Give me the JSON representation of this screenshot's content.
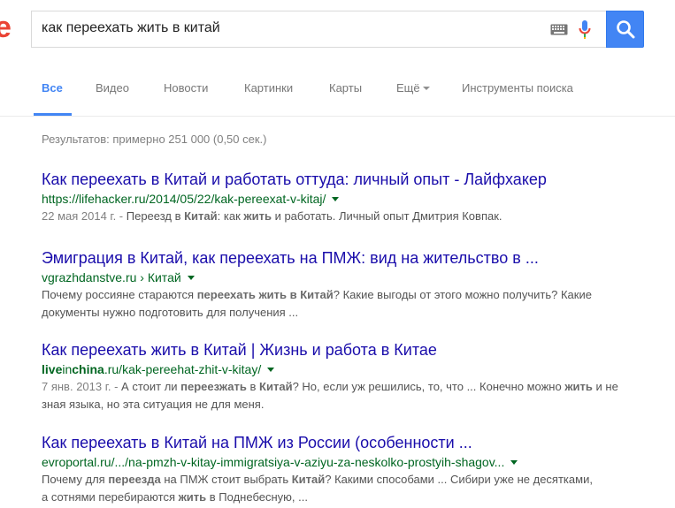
{
  "header": {
    "logo_fragment": "e",
    "search_query": "как переехать жить в китай",
    "icons": [
      "keyboard-icon",
      "microphone-icon",
      "search-icon"
    ],
    "colors": {
      "brand_blue": "#4285f4",
      "logo_red": "#ea4335"
    }
  },
  "tabs": {
    "all": "Все",
    "video": "Видео",
    "news": "Новости",
    "images": "Картинки",
    "maps": "Карты",
    "more": "Ещё",
    "tools": "Инструменты поиска"
  },
  "stats": "Результатов: примерно 251 000 (0,50 сек.)",
  "results": [
    {
      "title": "Как переехать в Китай и работать оттуда: личный опыт - Лайфхакер",
      "url": "https://lifehacker.ru/2014/05/22/kak-pereexat-v-kitaj/",
      "date": "22 мая 2014 г. - ",
      "snippet": [
        {
          "t": "Переезд в ",
          "b": false
        },
        {
          "t": "Китай",
          "b": true
        },
        {
          "t": ": как ",
          "b": false
        },
        {
          "t": "жить",
          "b": true
        },
        {
          "t": " и работать. Личный опыт Дмитрия Ковпак.",
          "b": false
        }
      ]
    },
    {
      "title": "Эмиграция в Китай, как переехать на ПМЖ: вид на жительство в ...",
      "url": "vgrazhdanstve.ru › Китай",
      "date": "",
      "snippet": [
        {
          "t": "Почему россияне стараются ",
          "b": false
        },
        {
          "t": "переехать жить в Китай",
          "b": true
        },
        {
          "t": "? Какие выгоды от этого можно получить? Какие документы нужно подготовить для получения ...",
          "b": false
        }
      ]
    },
    {
      "title": "Как переехать жить в Китай | Жизнь и работа в Китае",
      "url_parts": [
        {
          "t": "live",
          "b": true
        },
        {
          "t": "in",
          "b": false
        },
        {
          "t": "china",
          "b": true
        },
        {
          "t": ".ru/kak-pereehat-zhit-v-kitay/",
          "b": false
        }
      ],
      "date": "7 янв. 2013 г. - ",
      "snippet": [
        {
          "t": "А стоит ли ",
          "b": false
        },
        {
          "t": "переезжать",
          "b": true
        },
        {
          "t": " в ",
          "b": false
        },
        {
          "t": "Китай",
          "b": true
        },
        {
          "t": "? Но, если уж решились, то, что ... Конечно можно ",
          "b": false
        },
        {
          "t": "жить",
          "b": true
        },
        {
          "t": " и не зная языка, но эта ситуация не для меня.",
          "b": false
        }
      ]
    },
    {
      "title": "Как переехать в Китай на ПМЖ из России (особенности ...",
      "url": "evroportal.ru/.../na-pmzh-v-kitay-immigratsiya-v-aziyu-za-neskolko-prostyih-shagov...",
      "date": "",
      "snippet": [
        {
          "t": "Почему для ",
          "b": false
        },
        {
          "t": "переезда",
          "b": true
        },
        {
          "t": " на ПМЖ стоит выбрать ",
          "b": false
        },
        {
          "t": "Китай",
          "b": true
        },
        {
          "t": "? Какими способами ... Сибири уже не десятками, а сотнями перебираются ",
          "b": false
        },
        {
          "t": "жить",
          "b": true
        },
        {
          "t": " в Поднебесную, ...",
          "b": false
        }
      ]
    }
  ]
}
